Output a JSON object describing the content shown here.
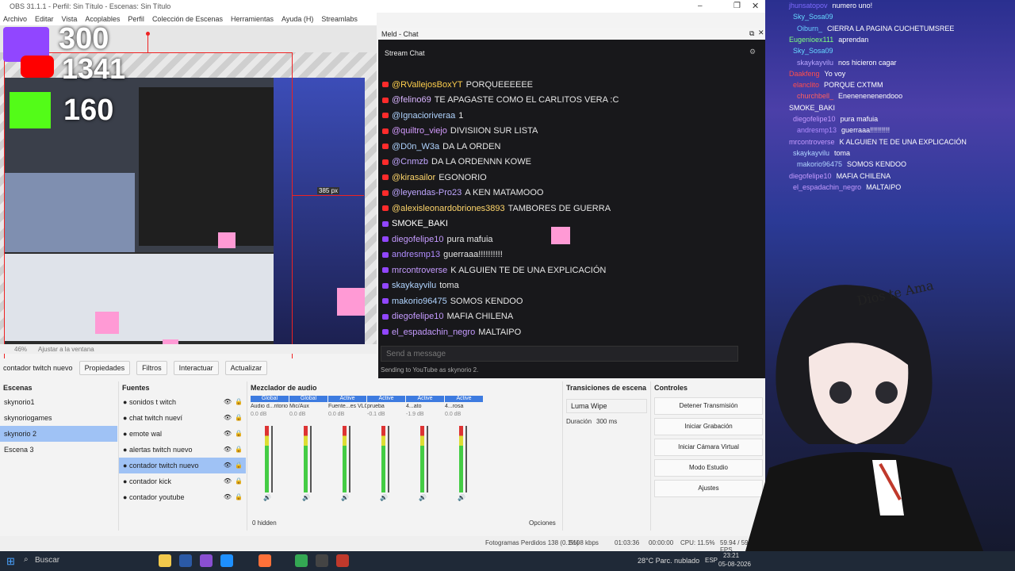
{
  "window": {
    "title": "OBS 31.1.1 - Perfil: Sin Título - Escenas: Sin Título"
  },
  "menu": [
    "Archivo",
    "Editar",
    "Vista",
    "Acoplables",
    "Perfil",
    "Colección de Escenas",
    "Herramientas",
    "Ayuda (H)",
    "Streamlabs"
  ],
  "stream_counters": {
    "viewers": "300",
    "youtube_viewers": "1341",
    "kick_viewers": "160"
  },
  "preview": {
    "size_label": "385 px",
    "zoom": "46%",
    "fit": "Ajustar a la ventana"
  },
  "source_toolbar": {
    "selected": "contador twitch nuevo",
    "properties": "Propiedades",
    "filters": "Filtros",
    "interact": "Interactuar",
    "refresh": "Actualizar"
  },
  "chat": {
    "title": "Meld - Chat",
    "subtitle": "Stream Chat",
    "placeholder": "Send a message",
    "sending_as": "Sending to YouTube as skynorio 2.",
    "messages": [
      {
        "user": "@RVallejosBoxYT",
        "text": "PORQUEEEEEE",
        "platform": "youtube",
        "color": "#ffcf4d"
      },
      {
        "user": "@felino69",
        "text": "TE APAGASTE COMO EL CARLITOS VERA :C",
        "platform": "youtube",
        "color": "#d9b4ff"
      },
      {
        "user": "@Ignacioriveraa",
        "text": "1",
        "platform": "youtube",
        "color": "#b0d4ff"
      },
      {
        "user": "@quiltro_viejo",
        "text": "DIVISIION SUR LISTA",
        "platform": "youtube",
        "color": "#d59cff"
      },
      {
        "user": "@D0n_W3a",
        "text": "DA LA ORDEN",
        "platform": "youtube",
        "color": "#b0d4ff"
      },
      {
        "user": "@Cnmzb",
        "text": "DA LA ORDENNN KOWE",
        "platform": "youtube",
        "color": "#c2a6ff"
      },
      {
        "user": "@kirasailor",
        "text": "EGONORIO",
        "platform": "youtube",
        "color": "#ffd66b"
      },
      {
        "user": "@leyendas-Pro23",
        "text": "A KEN MATAMOOO",
        "platform": "youtube",
        "color": "#bfa6ff"
      },
      {
        "user": "@alexisleonardobriones3893",
        "text": "TAMBORES DE GUERRA",
        "platform": "youtube",
        "color": "#ffd66b"
      },
      {
        "user": "SMOKE_BAKI",
        "text": "",
        "platform": "twitch",
        "color": "#ffffff"
      },
      {
        "user": "diegofelipe10",
        "text": "pura mafuia",
        "platform": "twitch",
        "color": "#c59bff"
      },
      {
        "user": "andresmp13",
        "text": "guerraaa!!!!!!!!!!",
        "platform": "twitch",
        "color": "#b08cff"
      },
      {
        "user": "mrcontroverse",
        "text": "K ALGUIEN TE DE UNA EXPLICACIÓN",
        "platform": "twitch",
        "color": "#c59bff"
      },
      {
        "user": "skaykayvilu",
        "text": "toma",
        "platform": "twitch",
        "color": "#b0d4ff"
      },
      {
        "user": "makorio96475",
        "text": "SOMOS KENDOO",
        "platform": "twitch",
        "color": "#b0d4ff"
      },
      {
        "user": "diegofelipe10",
        "text": "MAFIA CHILENA",
        "platform": "twitch",
        "color": "#c59bff"
      },
      {
        "user": "el_espadachin_negro",
        "text": "MALTAIPO",
        "platform": "twitch",
        "color": "#c59bff"
      }
    ]
  },
  "scenes": {
    "title": "Escenas",
    "items": [
      "skynorio1",
      "skynoriogames",
      "skynorio 2",
      "Escena 3"
    ],
    "selected": 2
  },
  "sources": {
    "title": "Fuentes",
    "items": [
      "sonidos t witch",
      "chat twitch nueví",
      "emote wal",
      "alertas twitch nuevo",
      "contador twitch nuevo",
      "contador kick",
      "contador youtube"
    ],
    "selected": 4
  },
  "mixer": {
    "title": "Mezclador de audio",
    "hidden": "0 hidden",
    "options": "Opciones",
    "channels": [
      {
        "tag": "Global",
        "name": "Audio d...ritorio",
        "db": "0.0 dB"
      },
      {
        "tag": "Global",
        "name": "Mic/Aux",
        "db": "0.0 dB"
      },
      {
        "tag": "Active",
        "name": "Fuente...es VLC",
        "db": "0.0 dB"
      },
      {
        "tag": "Active",
        "name": "prueba",
        "db": "-0.1 dB"
      },
      {
        "tag": "Active",
        "name": "4...ato",
        "db": "-1.9 dB"
      },
      {
        "tag": "Active",
        "name": "4...rosa",
        "db": "0.0 dB"
      }
    ]
  },
  "transitions": {
    "title": "Transiciones de escena",
    "type": "Luma Wipe",
    "duration_label": "Duración",
    "duration": "300 ms"
  },
  "controls": {
    "title": "Controles",
    "buttons": [
      "Detener Transmisión",
      "Iniciar Grabación",
      "Iniciar Cámara Virtual",
      "Modo Estudio",
      "Ajustes"
    ]
  },
  "status": {
    "dropped": "Fotogramas Perdidos 138 (0.1%)",
    "bitrate": "5108 kbps",
    "live_time": "01:03:36",
    "rec_time": "00:00:00",
    "cpu": "CPU: 11.5%",
    "fps": "59.94 / 59.94 FPS"
  },
  "overlay_chat": [
    {
      "user": "jhunsatopov",
      "text": "numero uno!",
      "color": "#7d6bff"
    },
    {
      "user": "Sky_Sosa09",
      "text": "",
      "color": "#66d9ff"
    },
    {
      "user": "Oiburn_",
      "text": "CIERRA LA PAGINA CUCHETUMSREE",
      "color": "#6ad0ff"
    },
    {
      "user": "Eugenioex111",
      "text": "aprendan",
      "color": "#7fff7f"
    },
    {
      "user": "Sky_Sosa09",
      "text": "",
      "color": "#66d9ff"
    },
    {
      "user": "skaykayvilu",
      "text": "nos hicieron cagar",
      "color": "#b8a6ff"
    },
    {
      "user": "Daakfeng",
      "text": "Yo voy",
      "color": "#ff4d4d"
    },
    {
      "user": "elanclito",
      "text": "PORQUE CXTMM",
      "color": "#ff4d4d"
    },
    {
      "user": "churchbell_",
      "text": "Enenenenenendooo",
      "color": "#ff5f5f"
    },
    {
      "user": "SMOKE_BAKI",
      "text": "",
      "color": "#ffffff"
    },
    {
      "user": "diegofelipe10",
      "text": "pura mafuia",
      "color": "#c59bff"
    },
    {
      "user": "andresmp13",
      "text": "guerraaa!!!!!!!!!!",
      "color": "#b08cff"
    },
    {
      "user": "mrcontroverse",
      "text": "K ALGUIEN TE DE UNA EXPLICACIÓN",
      "color": "#c59bff"
    },
    {
      "user": "skaykayvilu",
      "text": "toma",
      "color": "#b0d4ff"
    },
    {
      "user": "makorio96475",
      "text": "SOMOS KENDOO",
      "color": "#b0d4ff"
    },
    {
      "user": "diegofelipe10",
      "text": "MAFIA CHILENA",
      "color": "#c59bff"
    },
    {
      "user": "el_espadachin_negro",
      "text": "MALTAIPO",
      "color": "#c59bff"
    }
  ],
  "avatar_caption": "Dios te Ama",
  "taskbar": {
    "search": "Buscar",
    "weather": "28°C  Parc. nublado",
    "lang": "ESP",
    "time": "23:21",
    "date": "05-08-2026"
  }
}
